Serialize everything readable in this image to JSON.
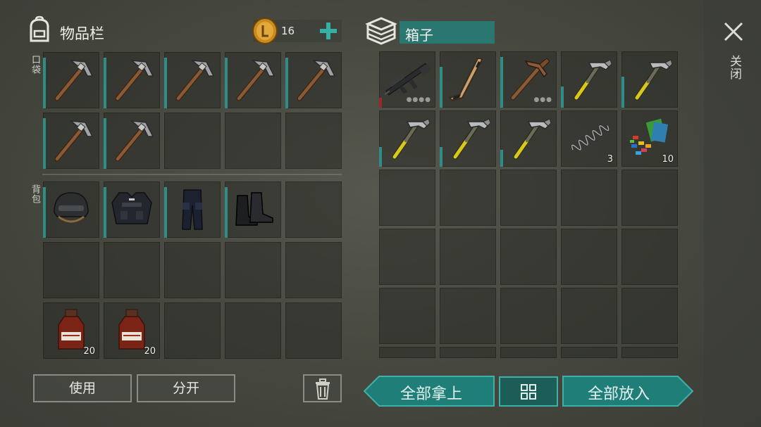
{
  "inventory": {
    "title": "物品栏",
    "pockets_label": "口袋",
    "backpack_label": "背包",
    "coins": "16",
    "slots": {
      "p1": {
        "icon": "pickaxe-icon"
      },
      "p2": {
        "icon": "pickaxe-icon"
      },
      "p3": {
        "icon": "pickaxe-icon"
      },
      "p4": {
        "icon": "pickaxe-icon"
      },
      "p5": {
        "icon": "pickaxe-icon"
      },
      "p6": {
        "icon": "pickaxe-icon"
      },
      "p7": {
        "icon": "pickaxe-icon"
      },
      "b1": {
        "icon": "helmet-icon"
      },
      "b2": {
        "icon": "police-vest-icon"
      },
      "b3": {
        "icon": "police-pants-icon"
      },
      "b4": {
        "icon": "boots-icon"
      },
      "b11": {
        "icon": "cough-syrup-icon",
        "count": "20"
      },
      "b12": {
        "icon": "cough-syrup-icon",
        "count": "20"
      }
    }
  },
  "box": {
    "title": "箱子",
    "slots": {
      "c1": {
        "icon": "assault-rifle-icon"
      },
      "c2": {
        "icon": "hockey-stick-icon"
      },
      "c3": {
        "icon": "pickaxe-icon"
      },
      "c4": {
        "icon": "hammer-icon"
      },
      "c5": {
        "icon": "hammer-icon"
      },
      "c6": {
        "icon": "hammer-icon"
      },
      "c7": {
        "icon": "hammer-icon"
      },
      "c8": {
        "icon": "hammer-icon"
      },
      "c9": {
        "icon": "spring-icon",
        "count": "3"
      },
      "c10": {
        "icon": "scrap-icon",
        "count": "10"
      }
    }
  },
  "close_label": "关闭",
  "buttons": {
    "use": "使用",
    "split": "分开",
    "take_all": "全部拿上",
    "put_all": "全部放入"
  },
  "colors": {
    "accent": "#2f8c86",
    "teal_button": "#1f7f78",
    "teal_border": "#3fb0a6",
    "durability_red": "#9c2a24"
  }
}
